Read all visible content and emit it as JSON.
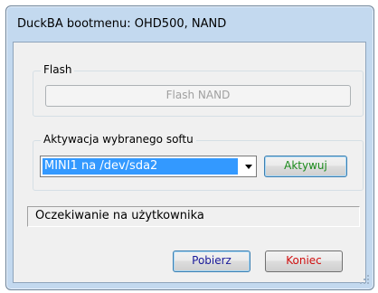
{
  "window": {
    "title": "DuckBA bootmenu: OHD500, NAND"
  },
  "flash_group": {
    "label": "Flash",
    "button_label": "Flash NAND"
  },
  "activation_group": {
    "label": "Aktywacja wybranego softu",
    "selected_option": "MINI1 na /dev/sda2",
    "activate_label": "Aktywuj",
    "activate_color": "#1a8a1a"
  },
  "status": {
    "text": "Oczekiwanie na użytkownika"
  },
  "footer": {
    "download_label": "Pobierz",
    "download_color": "#1a1a9a",
    "close_label": "Koniec",
    "close_color": "#d01010"
  }
}
